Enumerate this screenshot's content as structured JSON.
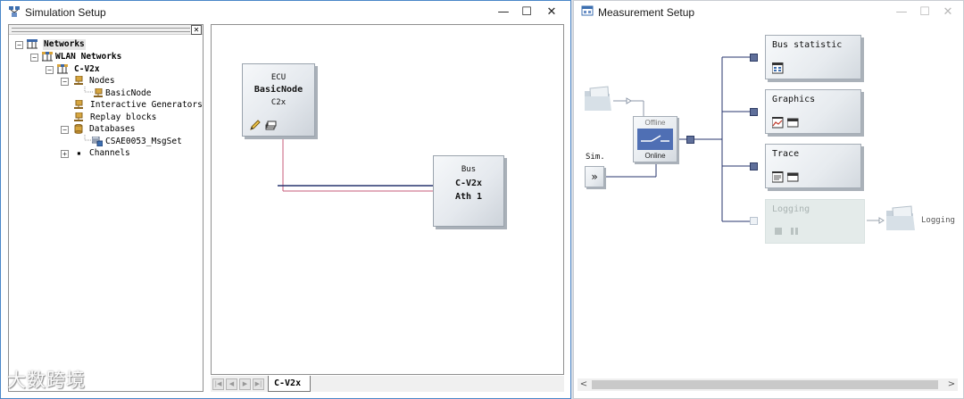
{
  "left_window": {
    "title": "Simulation Setup",
    "controls": {
      "minimize": "—",
      "maximize": "☐",
      "close": "✕"
    },
    "tree": {
      "close_glyph": "✕",
      "items": [
        {
          "label": "Networks",
          "expander": "−"
        },
        {
          "label": "WLAN Networks",
          "expander": "−"
        },
        {
          "label": "C-V2x",
          "expander": "−"
        },
        {
          "label": "Nodes",
          "expander": "−"
        },
        {
          "label": "BasicNode"
        },
        {
          "label": "Interactive Generators"
        },
        {
          "label": "Replay blocks"
        },
        {
          "label": "Databases",
          "expander": "−"
        },
        {
          "label": "CSAE0053_MsgSet"
        },
        {
          "label": "Channels",
          "expander": "+",
          "bullet": "▪"
        }
      ]
    },
    "canvas": {
      "ecu": {
        "line1": "ECU",
        "line2": "BasicNode",
        "line3": "C2x"
      },
      "bus": {
        "line1": "Bus",
        "line2": "C-V2x",
        "line3": "Ath 1"
      }
    },
    "sheet_tabs": {
      "nav": [
        "|◀",
        "◀",
        "▶",
        "▶|"
      ],
      "active": "C-V2x"
    }
  },
  "right_window": {
    "title": "Measurement Setup",
    "controls": {
      "minimize": "—",
      "maximize": "☐",
      "close": "✕"
    },
    "switch": {
      "offline": "Offline",
      "online": "Online"
    },
    "sim_label": "Sim.",
    "sim_button": "»",
    "blocks": [
      {
        "label": "Bus statistic",
        "icons": [
          "statistics-window-icon"
        ]
      },
      {
        "label": "Graphics",
        "icons": [
          "graphics-window-icon",
          "window-icon"
        ]
      },
      {
        "label": "Trace",
        "icons": [
          "trace-window-icon",
          "window-icon"
        ]
      },
      {
        "label": "Logging",
        "icons": [
          "record-icon",
          "pause-icon"
        ],
        "disabled": true
      }
    ],
    "logging_output": "Logging",
    "scroll_left": "<",
    "scroll_right": ">"
  },
  "watermark": "大数跨境",
  "colors": {
    "active_border": "#4a86c8",
    "connector": "#5f6f9a",
    "line_dark": "#27346e",
    "line_pink": "#c75b7a"
  }
}
